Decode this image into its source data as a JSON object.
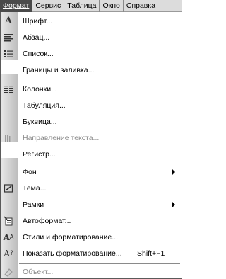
{
  "menubar": {
    "items": [
      {
        "label": "Формат",
        "active": true
      },
      {
        "label": "Сервис"
      },
      {
        "label": "Таблица"
      },
      {
        "label": "Окно"
      },
      {
        "label": "Справка"
      }
    ]
  },
  "menu": {
    "items": [
      {
        "label": "Шрифт...",
        "icon": "font-A-icon"
      },
      {
        "label": "Абзац...",
        "icon": "paragraph-icon"
      },
      {
        "label": "Список...",
        "icon": "list-icon"
      },
      {
        "label": "Границы и заливка...",
        "icon": ""
      },
      {
        "label": "Колонки...",
        "icon": "columns-icon"
      },
      {
        "label": "Табуляция...",
        "icon": ""
      },
      {
        "label": "Буквица...",
        "icon": ""
      },
      {
        "label": "Направление текста...",
        "icon": "text-direction-icon",
        "disabled": true
      },
      {
        "label": "Регистр...",
        "icon": ""
      },
      {
        "label": "Фон",
        "icon": "",
        "submenu": true
      },
      {
        "label": "Тема...",
        "icon": "theme-icon"
      },
      {
        "label": "Рамки",
        "icon": "",
        "submenu": true
      },
      {
        "label": "Автоформат...",
        "icon": "autoformat-icon"
      },
      {
        "label": "Стили и форматирование...",
        "icon": "styles-icon"
      },
      {
        "label": "Показать форматирование...",
        "icon": "reveal-formatting-icon",
        "shortcut": "Shift+F1"
      },
      {
        "label": "Объект...",
        "icon": "object-icon",
        "disabled": true
      }
    ]
  }
}
